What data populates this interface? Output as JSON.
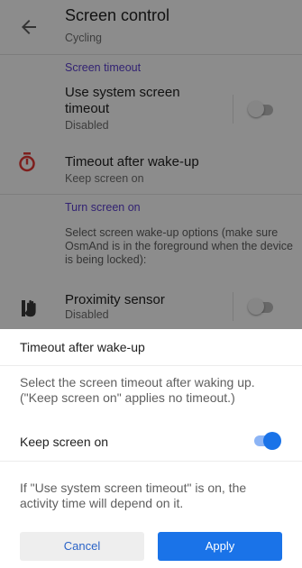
{
  "header": {
    "title": "Screen control",
    "subtitle": "Cycling"
  },
  "sections": {
    "timeout_header": "Screen timeout",
    "turn_on_header": "Turn screen on"
  },
  "rows": {
    "system_timeout": {
      "title": "Use system screen timeout",
      "desc": "Disabled",
      "enabled": false
    },
    "timeout_wakeup": {
      "title": "Timeout after wake-up",
      "desc": "Keep screen on"
    },
    "wake_note": "Select screen wake-up options (make sure OsmAnd is in the foreground when the device is being locked):",
    "proximity": {
      "title": "Proximity sensor",
      "desc": "Disabled",
      "enabled": false
    }
  },
  "sheet": {
    "title": "Timeout after wake-up",
    "description": "Select the screen timeout after waking up. (\"Keep screen on\" applies no timeout.)",
    "option_label": "Keep screen on",
    "option_enabled": true,
    "note": "If \"Use system screen timeout\" is on, the activity time will depend on it.",
    "cancel_label": "Cancel",
    "apply_label": "Apply"
  },
  "colors": {
    "accent": "#1a73e8",
    "section_header": "#5b3fd0",
    "timer_icon": "#e53935"
  },
  "icons": {
    "back": "arrow-left-icon",
    "timer": "stopwatch-icon",
    "proximity": "hand-icon"
  }
}
